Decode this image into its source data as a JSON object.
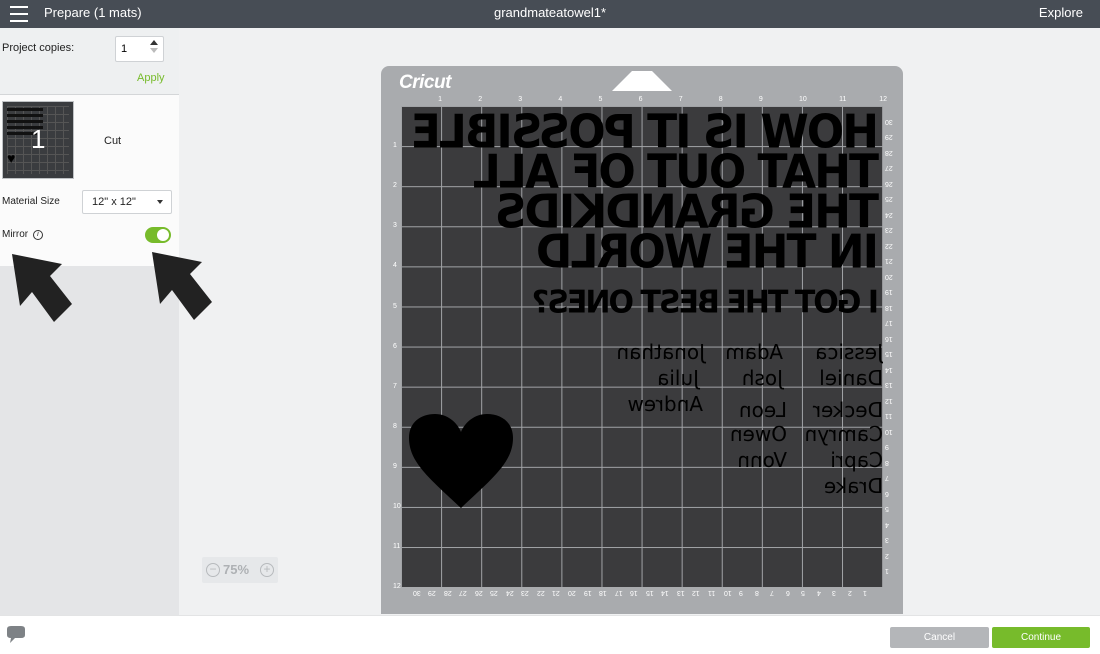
{
  "topbar": {
    "title": "Prepare (1 mats)",
    "document": "grandmateatowel1*",
    "explore": "Explore"
  },
  "sidebar": {
    "project_copies_label": "Project copies:",
    "copies_value": "1",
    "apply": "Apply",
    "mat_number": "1",
    "mat_label": "Cut",
    "material_size_label": "Material Size",
    "material_size_value": "12\" x 12\"",
    "mirror_label": "Mirror",
    "mirror_on": true
  },
  "zoom": {
    "level": "75%"
  },
  "mat": {
    "brand": "Cricut",
    "ruler_top": [
      "1",
      "2",
      "3",
      "4",
      "5",
      "6",
      "7",
      "8",
      "9",
      "10",
      "11",
      "12"
    ],
    "ruler_left": [
      "1",
      "2",
      "3",
      "4",
      "5",
      "6",
      "7",
      "8",
      "9",
      "10",
      "11",
      "12"
    ],
    "ruler_right": [
      "30",
      "29",
      "28",
      "27",
      "26",
      "25",
      "24",
      "23",
      "22",
      "21",
      "20",
      "19",
      "18",
      "17",
      "16",
      "15",
      "14",
      "13",
      "12",
      "11",
      "10",
      "9",
      "8",
      "7",
      "6",
      "5",
      "4",
      "3",
      "2",
      "1"
    ],
    "ruler_bottom": [
      "30",
      "29",
      "28",
      "27",
      "26",
      "25",
      "24",
      "23",
      "22",
      "21",
      "20",
      "19",
      "18",
      "17",
      "16",
      "15",
      "14",
      "13",
      "12",
      "11",
      "10",
      "9",
      "8",
      "7",
      "6",
      "5",
      "4",
      "3",
      "2",
      "1"
    ],
    "design_lines": [
      "HOW IS IT POSSIBLE",
      "THAT OUT OF ALL",
      "THE GRANDKIDS",
      "IN THE WORLD",
      "I GOT THE BEST ONES?"
    ],
    "names_col1": [
      "Jessica",
      "Daniel",
      "Decker",
      "Camryn",
      "Capri",
      "Drake"
    ],
    "names_col2": [
      "Adam",
      "Josh",
      "Leon",
      "Owen",
      "Vonn"
    ],
    "names_col3": [
      "Jonathan",
      "Julia",
      "Andrew"
    ]
  },
  "footer": {
    "cancel": "Cancel",
    "continue": "Continue"
  },
  "colors": {
    "accent": "#77bb2b",
    "topbar": "#474d55",
    "mat": "#3b3b3d"
  }
}
